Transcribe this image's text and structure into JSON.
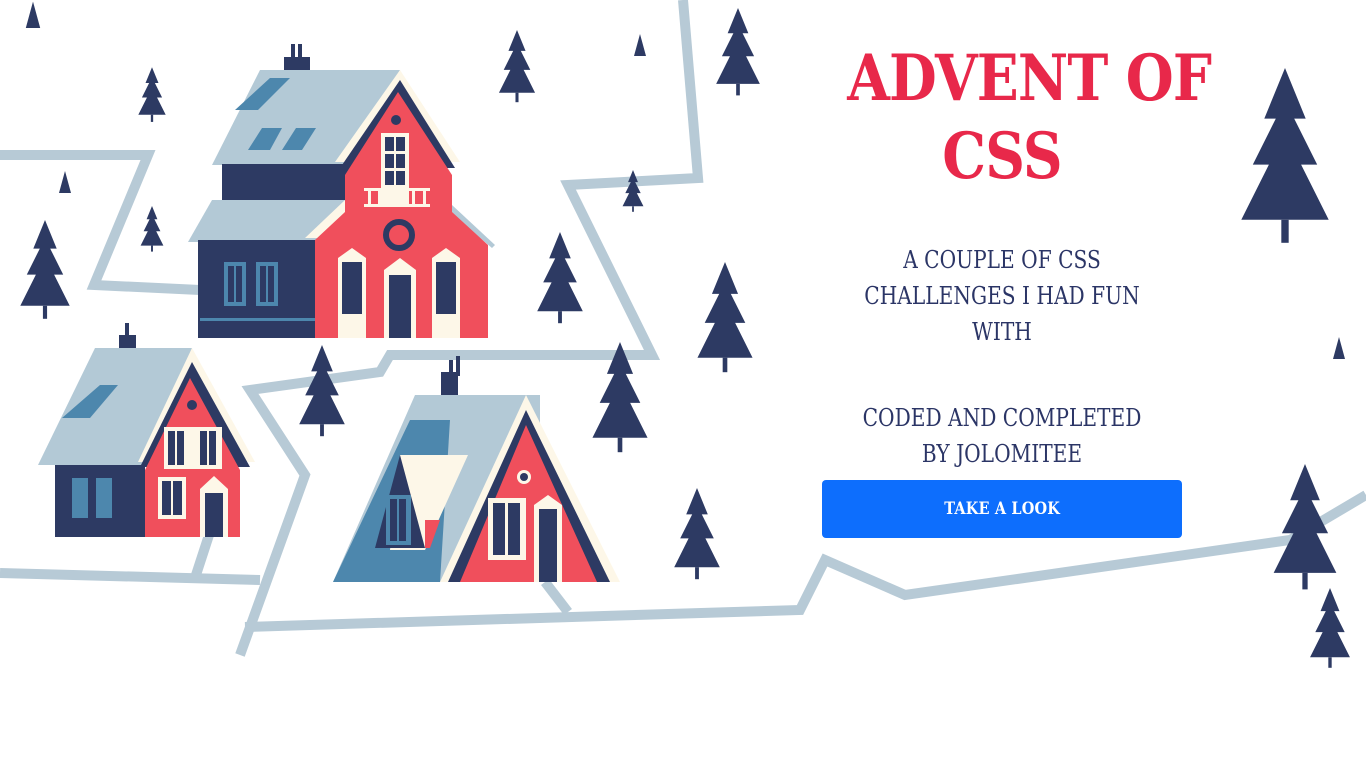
{
  "hero": {
    "title_line1": "ADVENT OF",
    "title_line2": "CSS",
    "subtitle": "A COUPLE OF CSS CHALLENGES I HAD FUN WITH",
    "credit": "CODED AND COMPLETED BY JOLOMITEE",
    "cta_label": "TAKE A LOOK"
  },
  "colors": {
    "accent": "#e8284a",
    "text": "#2b3566",
    "button": "#0d6efd",
    "road": "#b7cad6",
    "tree": "#2d3a63",
    "house_red": "#f04f5c",
    "roof_snow": "#b3c9d6"
  },
  "illustration": {
    "icon": "winter-village-illustration"
  }
}
